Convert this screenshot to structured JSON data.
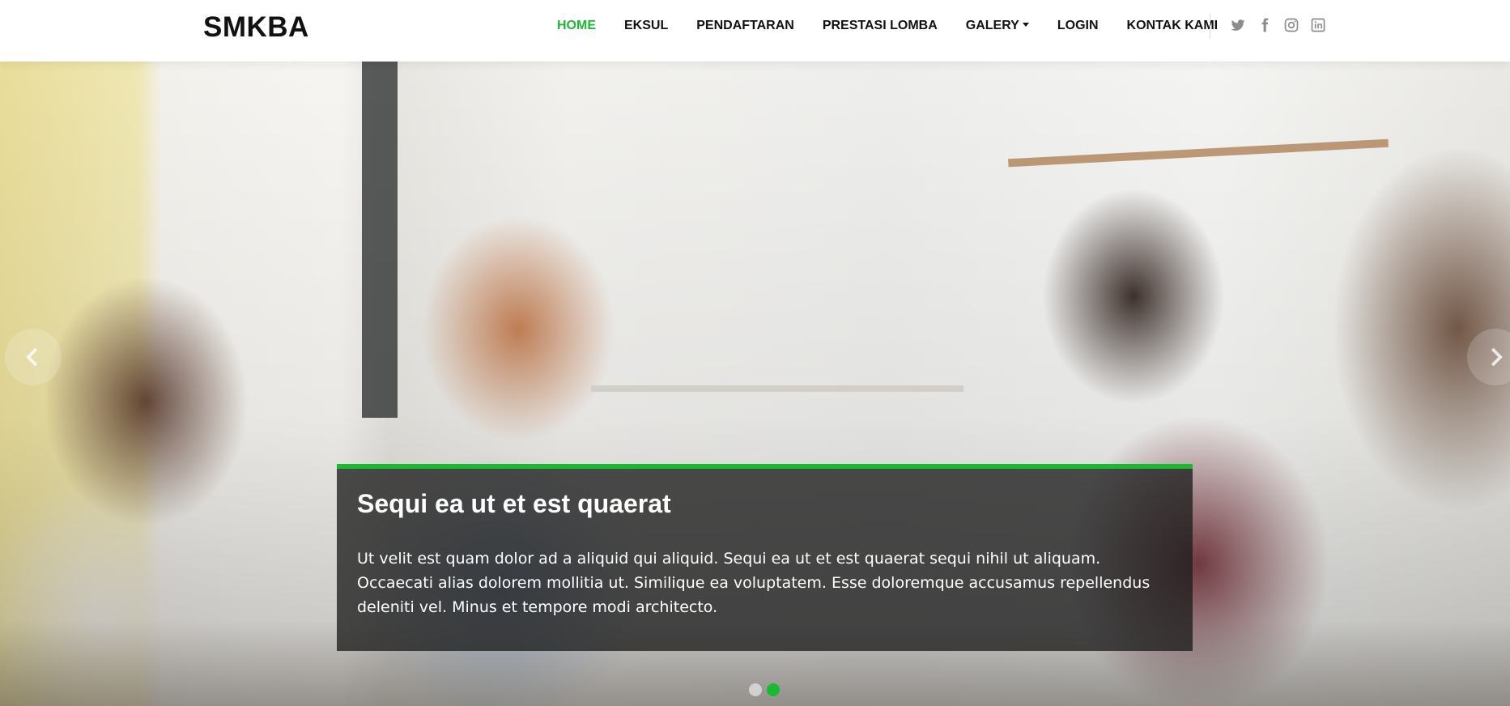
{
  "header": {
    "logo": "SMKBA",
    "nav": [
      {
        "label": "HOME",
        "active": true
      },
      {
        "label": "EKSUL"
      },
      {
        "label": "PENDAFTARAN"
      },
      {
        "label": "PRESTASI LOMBA"
      },
      {
        "label": "GALERY",
        "dropdown": true
      },
      {
        "label": "LOGIN"
      },
      {
        "label": "KONTAK KAMI"
      }
    ],
    "social": [
      "twitter-icon",
      "facebook-icon",
      "instagram-icon",
      "linkedin-icon"
    ]
  },
  "hero": {
    "background": "photo-people-meeting-at-table",
    "caption": {
      "title": "Sequi ea ut et est quaerat",
      "text": "Ut velit est quam dolor ad a aliquid qui aliquid. Sequi ea ut et est quaerat sequi nihil ut aliquam. Occaecati alias dolorem mollitia ut. Similique ea voluptatem. Esse doloremque accusamus repellendus deleniti vel. Minus et tempore modi architecto."
    },
    "slides": 2,
    "active_slide": 2
  },
  "colors": {
    "accent": "#1bb932",
    "text": "#111111",
    "caption_bg": "rgba(30,30,30,0.78)"
  }
}
